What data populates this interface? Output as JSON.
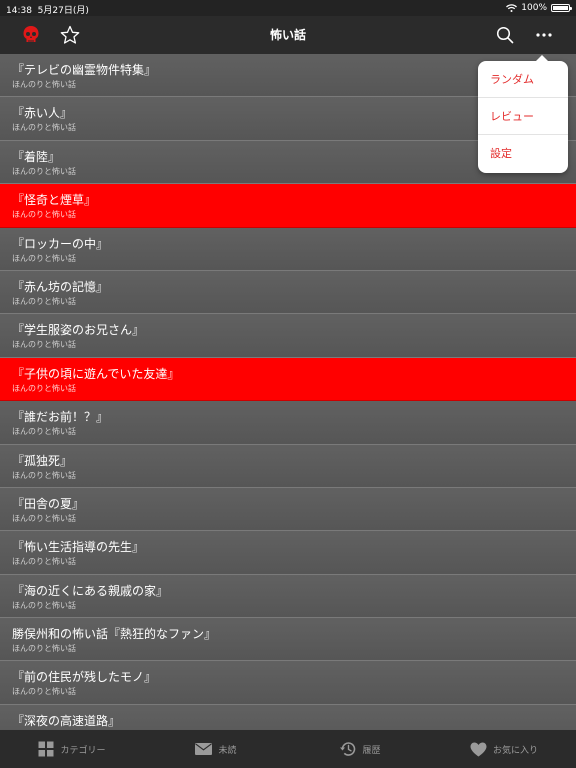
{
  "status_bar": {
    "time": "14:38",
    "date": "5月27日(月)",
    "battery": "100%",
    "battery_level": 1.0
  },
  "nav": {
    "title": "怖い話"
  },
  "menu": {
    "items": [
      "ランダム",
      "レビュー",
      "設定"
    ]
  },
  "list": {
    "items": [
      {
        "title": "『テレビの幽霊物件特集』",
        "subtitle": "ほんのりと怖い話",
        "highlighted": false
      },
      {
        "title": "『赤い人』",
        "subtitle": "ほんのりと怖い話",
        "highlighted": false
      },
      {
        "title": "『着陸』",
        "subtitle": "ほんのりと怖い話",
        "highlighted": false
      },
      {
        "title": "『怪奇と煙草』",
        "subtitle": "ほんのりと怖い話",
        "highlighted": true
      },
      {
        "title": "『ロッカーの中』",
        "subtitle": "ほんのりと怖い話",
        "highlighted": false
      },
      {
        "title": "『赤ん坊の記憶』",
        "subtitle": "ほんのりと怖い話",
        "highlighted": false
      },
      {
        "title": "『学生服姿のお兄さん』",
        "subtitle": "ほんのりと怖い話",
        "highlighted": false
      },
      {
        "title": "『子供の頃に遊んでいた友達』",
        "subtitle": "ほんのりと怖い話",
        "highlighted": true
      },
      {
        "title": "『誰だお前！？』",
        "subtitle": "ほんのりと怖い話",
        "highlighted": false
      },
      {
        "title": "『孤独死』",
        "subtitle": "ほんのりと怖い話",
        "highlighted": false
      },
      {
        "title": "『田舎の夏』",
        "subtitle": "ほんのりと怖い話",
        "highlighted": false
      },
      {
        "title": "『怖い生活指導の先生』",
        "subtitle": "ほんのりと怖い話",
        "highlighted": false
      },
      {
        "title": "『海の近くにある親戚の家』",
        "subtitle": "ほんのりと怖い話",
        "highlighted": false
      },
      {
        "title": "勝俣州和の怖い話『熱狂的なファン』",
        "subtitle": "ほんのりと怖い話",
        "highlighted": false
      },
      {
        "title": "『前の住民が残したモノ』",
        "subtitle": "ほんのりと怖い話",
        "highlighted": false
      },
      {
        "title": "『深夜の高速道路』",
        "subtitle": "",
        "highlighted": false
      }
    ]
  },
  "tabs": [
    {
      "label": "カテゴリー",
      "icon": "grid-icon"
    },
    {
      "label": "未読",
      "icon": "envelope-icon"
    },
    {
      "label": "履歴",
      "icon": "history-icon"
    },
    {
      "label": "お気に入り",
      "icon": "heart-icon"
    }
  ],
  "colors": {
    "accent": "#ff0000",
    "menu_text": "#e32a2a",
    "bar": "#2b2b2b"
  }
}
